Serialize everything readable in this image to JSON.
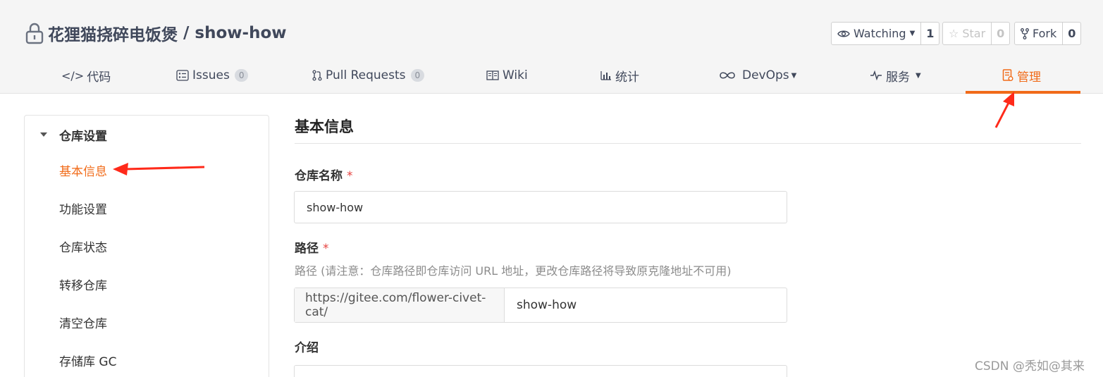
{
  "repo": {
    "owner": "花狸猫挠碎电饭煲",
    "separator": "/",
    "name": "show-how"
  },
  "social": {
    "watch_label": "Watching",
    "watch_count": "1",
    "star_label": "Star",
    "star_count": "0",
    "fork_label": "Fork",
    "fork_count": "0"
  },
  "tabs": {
    "code": "代码",
    "issues": "Issues",
    "issues_count": "0",
    "pulls": "Pull Requests",
    "pulls_count": "0",
    "wiki": "Wiki",
    "stats": "统计",
    "devops": "DevOps",
    "services": "服务",
    "manage": "管理"
  },
  "sidebar": {
    "group": "仓库设置",
    "items": [
      "基本信息",
      "功能设置",
      "仓库状态",
      "转移仓库",
      "清空仓库",
      "存储库 GC"
    ]
  },
  "main": {
    "title": "基本信息",
    "name_label": "仓库名称",
    "name_value": "show-how",
    "path_label": "路径",
    "path_hint": "路径 (请注意：仓库路径即仓库访问 URL 地址，更改仓库路径将导致原克隆地址不可用)",
    "path_prefix": "https://gitee.com/flower-civet-cat/",
    "path_value": "show-how",
    "intro_label": "介绍",
    "required_mark": "*"
  },
  "watermark": "CSDN @秃如@其来",
  "colors": {
    "accent": "#f16b19",
    "annotation_arrow": "#ff2a1a",
    "required": "#e64340"
  }
}
